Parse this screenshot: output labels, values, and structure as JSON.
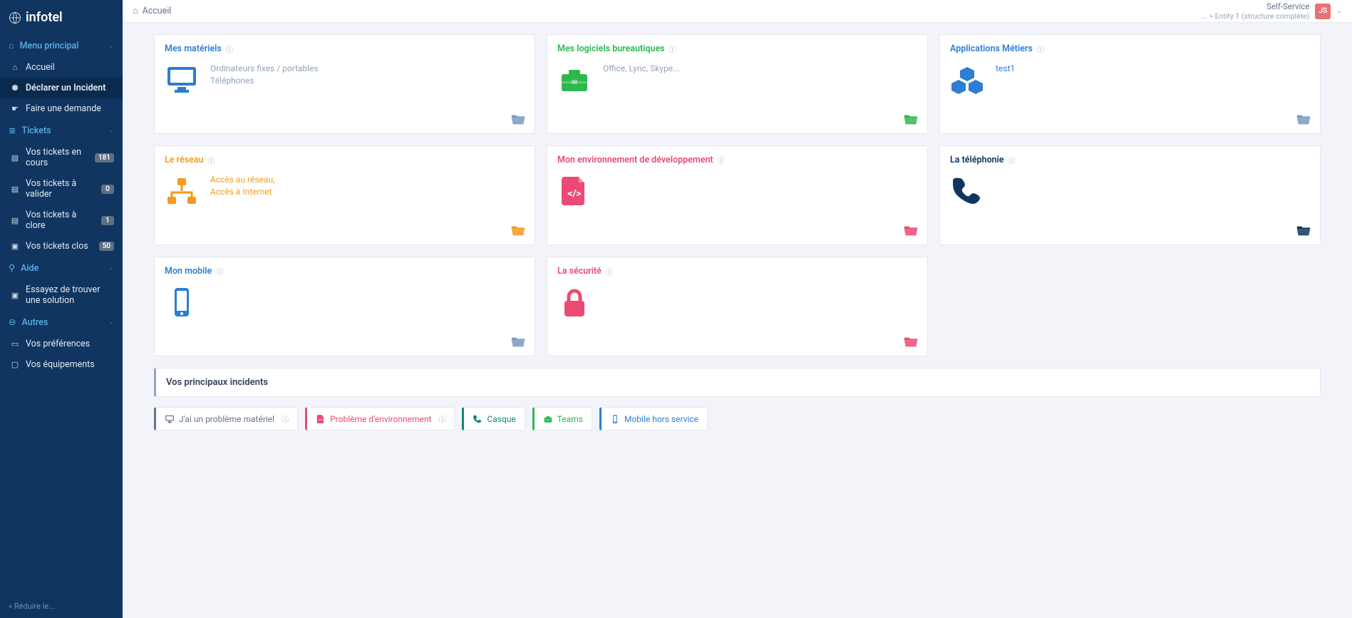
{
  "brand": "infotel",
  "breadcrumb": {
    "home_icon": "⌂",
    "label": "Accueil"
  },
  "topRight": {
    "profile": "Self-Service",
    "entity": "... > Entity 1 (structure complète)",
    "initials": "JS"
  },
  "menu": {
    "main": {
      "label": "Menu principal"
    },
    "accueil": "Accueil",
    "declarer": "Déclarer un Incident",
    "demande": "Faire une demande",
    "tickets_head": "Tickets",
    "tickets": {
      "encours": {
        "label": "Vos tickets en cours",
        "count": "181"
      },
      "valider": {
        "label": "Vos tickets à valider",
        "count": "0"
      },
      "clore": {
        "label": "Vos tickets à clore",
        "count": "1"
      },
      "clos": {
        "label": "Vos tickets clos",
        "count": "50"
      }
    },
    "aide_head": "Aide",
    "solution": "Essayez de trouver une solution",
    "autres_head": "Autres",
    "prefs": "Vos préférences",
    "equip": "Vos équipements",
    "reduire": "Réduire le..."
  },
  "cards": [
    {
      "title": "Mes matériels",
      "desc": "Ordinateurs fixes / portables\nTéléphones",
      "theme": "blue",
      "icon": "desktop",
      "folder": "#7a99c2"
    },
    {
      "title": "Mes logiciels bureautiques",
      "desc": "Office, Lync, Skype...",
      "theme": "green",
      "icon": "briefcase",
      "folder": "#2db84d"
    },
    {
      "title": "Applications Métiers",
      "desc": "test1",
      "theme": "blue",
      "icon": "cubes",
      "folder": "#7a99c2"
    },
    {
      "title": "Le réseau",
      "desc": "Accès au réseau,\nAccès à Internet",
      "theme": "orange",
      "icon": "network",
      "folder": "#f29b1f"
    },
    {
      "title": "Mon environnement de développement",
      "desc": "",
      "theme": "pink",
      "icon": "codefile",
      "folder": "#e94b73"
    },
    {
      "title": "La téléphonie",
      "desc": "",
      "theme": "navy",
      "icon": "phone",
      "folder": "#0f3560"
    },
    {
      "title": "Mon mobile",
      "desc": "",
      "theme": "blue",
      "icon": "mobile",
      "folder": "#7a99c2"
    },
    {
      "title": "La sécurité",
      "desc": "",
      "theme": "pink",
      "icon": "lock",
      "folder": "#e94b73"
    }
  ],
  "incidents": {
    "title": "Vos principaux incidents",
    "items": [
      {
        "label": "J'ai un problème matériel",
        "theme": "grey",
        "icon": "desktop",
        "info": true
      },
      {
        "label": "Problème d'environnement",
        "theme": "pink",
        "icon": "codefile",
        "info": true
      },
      {
        "label": "Casque",
        "theme": "teal",
        "icon": "phone",
        "info": false
      },
      {
        "label": "Teams",
        "theme": "green",
        "icon": "briefcase",
        "info": false
      },
      {
        "label": "Mobile hors service",
        "theme": "blue",
        "icon": "mobile",
        "info": false
      }
    ]
  }
}
